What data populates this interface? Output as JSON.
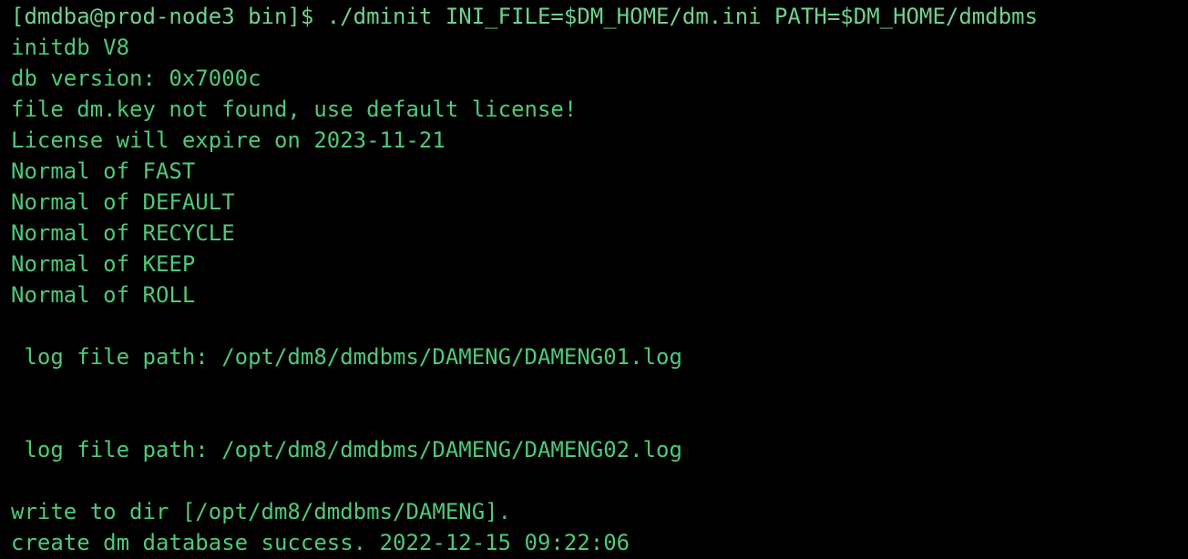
{
  "terminal": {
    "text_color": "#4ec97a",
    "background_color": "#000000",
    "lines": [
      "[dmdba@prod-node3 bin]$ ./dminit INI_FILE=$DM_HOME/dm.ini PATH=$DM_HOME/dmdbms",
      "initdb V8",
      "db version: 0x7000c",
      "file dm.key not found, use default license!",
      "License will expire on 2023-11-21",
      "Normal of FAST",
      "Normal of DEFAULT",
      "Normal of RECYCLE",
      "Normal of KEEP",
      "Normal of ROLL",
      "",
      " log file path: /opt/dm8/dmdbms/DAMENG/DAMENG01.log",
      "",
      "",
      " log file path: /opt/dm8/dmdbms/DAMENG/DAMENG02.log",
      "",
      "write to dir [/opt/dm8/dmdbms/DAMENG].",
      "create dm database success. 2022-12-15 09:22:06"
    ]
  }
}
